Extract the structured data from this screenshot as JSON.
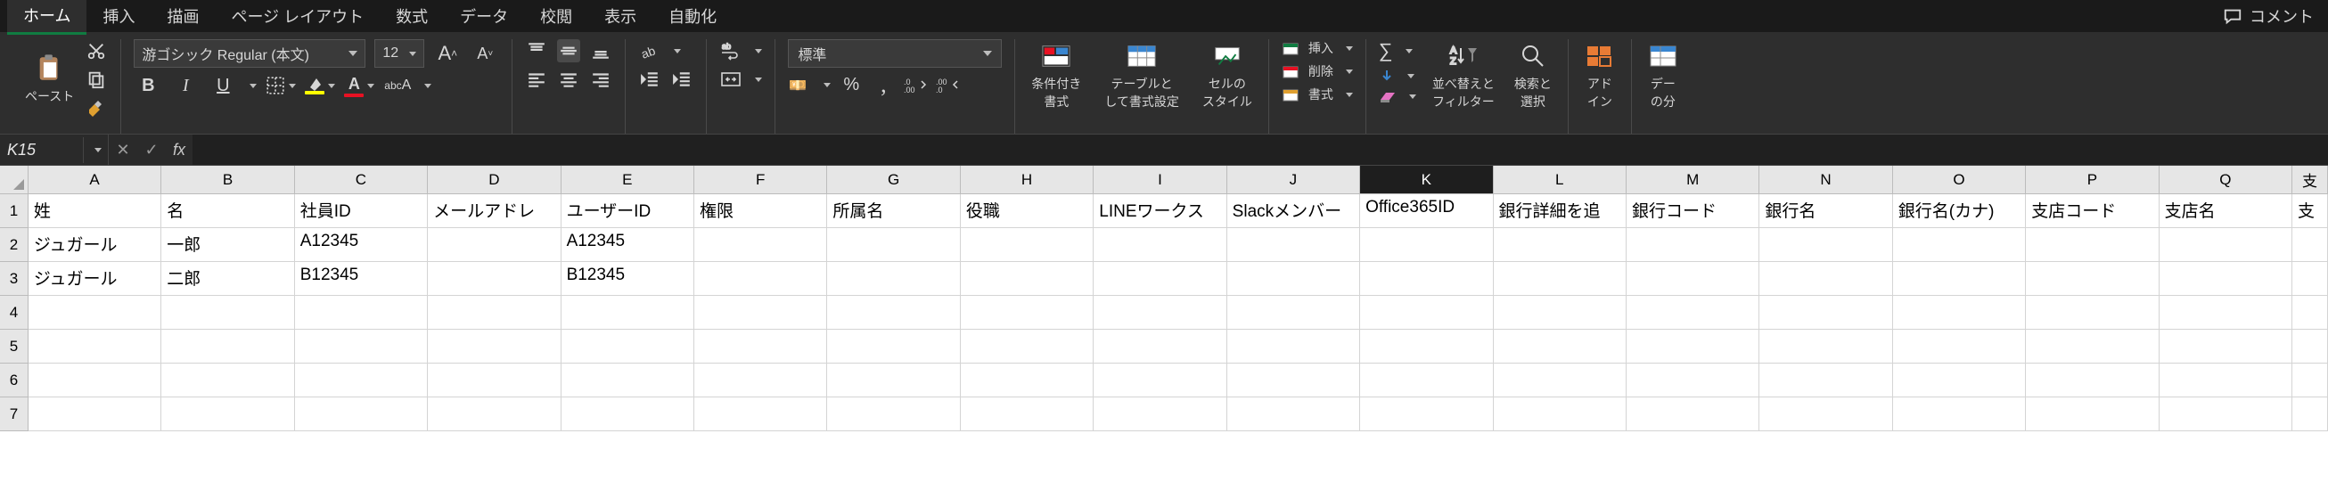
{
  "tabs": [
    "ホーム",
    "挿入",
    "描画",
    "ページ レイアウト",
    "数式",
    "データ",
    "校閲",
    "表示",
    "自動化"
  ],
  "active_tab": 0,
  "top_right": {
    "comments": "コメント"
  },
  "ribbon": {
    "clipboard": {
      "paste": "ペースト"
    },
    "font": {
      "name": "游ゴシック Regular (本文)",
      "size": "12"
    },
    "number": {
      "format": "標準"
    },
    "cond_fmt": "条件付き\n書式",
    "table_fmt": "テーブルと\nして書式設定",
    "cell_styles": "セルの\nスタイル",
    "cells": {
      "insert": "挿入",
      "delete": "削除",
      "format": "書式"
    },
    "editing": {
      "sort": "並べ替えと\nフィルター",
      "find": "検索と\n選択"
    },
    "addins": "アド\nイン",
    "data_analysis": "デー\nの分"
  },
  "formula_bar": {
    "name_box": "K15",
    "formula": ""
  },
  "grid": {
    "column_letters": [
      "A",
      "B",
      "C",
      "D",
      "E",
      "F",
      "G",
      "H",
      "I",
      "J",
      "K",
      "L",
      "M",
      "N",
      "O",
      "P",
      "Q",
      "支"
    ],
    "selected_col_index": 10,
    "row_heads": [
      "1",
      "2",
      "3",
      "4",
      "5",
      "6",
      "7"
    ],
    "rows": [
      [
        "姓",
        "名",
        "社員ID",
        "メールアドレ",
        "ユーザーID",
        "権限",
        "所属名",
        "役職",
        "LINEワークス",
        "Slackメンバー",
        "Office365ID",
        "銀行詳細を追",
        "銀行コード",
        "銀行名",
        "銀行名(カナ)",
        "支店コード",
        "支店名",
        "支"
      ],
      [
        "ジュガール",
        "一郎",
        "A12345",
        "",
        "A12345",
        "",
        "",
        "",
        "",
        "",
        "",
        "",
        "",
        "",
        "",
        "",
        "",
        ""
      ],
      [
        "ジュガール",
        "二郎",
        "B12345",
        "",
        "B12345",
        "",
        "",
        "",
        "",
        "",
        "",
        "",
        "",
        "",
        "",
        "",
        "",
        ""
      ],
      [
        "",
        "",
        "",
        "",
        "",
        "",
        "",
        "",
        "",
        "",
        "",
        "",
        "",
        "",
        "",
        "",
        "",
        ""
      ],
      [
        "",
        "",
        "",
        "",
        "",
        "",
        "",
        "",
        "",
        "",
        "",
        "",
        "",
        "",
        "",
        "",
        "",
        ""
      ],
      [
        "",
        "",
        "",
        "",
        "",
        "",
        "",
        "",
        "",
        "",
        "",
        "",
        "",
        "",
        "",
        "",
        "",
        ""
      ],
      [
        "",
        "",
        "",
        "",
        "",
        "",
        "",
        "",
        "",
        "",
        "",
        "",
        "",
        "",
        "",
        "",
        "",
        ""
      ]
    ]
  }
}
